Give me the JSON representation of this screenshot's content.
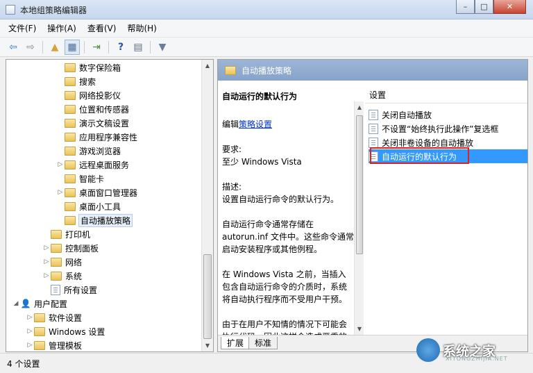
{
  "window": {
    "title": "本地组策略编辑器",
    "minimize": "–",
    "maximize": "□",
    "close": "✕"
  },
  "menu": [
    "文件(F)",
    "操作(A)",
    "查看(V)",
    "帮助(H)"
  ],
  "toolbar": {
    "icons": [
      "back-arrow-icon",
      "forward-arrow-icon",
      "folder-up-icon",
      "show-hide-tree-icon",
      "export-list-icon",
      "help-icon",
      "properties-icon",
      "filter-icon"
    ]
  },
  "tree": {
    "items": [
      {
        "label": "数字保险箱",
        "expandable": false,
        "icon": "folder"
      },
      {
        "label": "搜索",
        "expandable": false,
        "icon": "folder"
      },
      {
        "label": "网络投影仪",
        "expandable": false,
        "icon": "folder"
      },
      {
        "label": "位置和传感器",
        "expandable": false,
        "icon": "folder"
      },
      {
        "label": "演示文稿设置",
        "expandable": false,
        "icon": "folder"
      },
      {
        "label": "应用程序兼容性",
        "expandable": false,
        "icon": "folder"
      },
      {
        "label": "游戏浏览器",
        "expandable": false,
        "icon": "folder"
      },
      {
        "label": "远程桌面服务",
        "expandable": true,
        "icon": "folder"
      },
      {
        "label": "智能卡",
        "expandable": false,
        "icon": "folder"
      },
      {
        "label": "桌面窗口管理器",
        "expandable": true,
        "icon": "folder"
      },
      {
        "label": "桌面小工具",
        "expandable": false,
        "icon": "folder"
      },
      {
        "label": "自动播放策略",
        "expandable": false,
        "icon": "folder",
        "selected": true
      },
      {
        "label": "打印机",
        "expandable": false,
        "icon": "folder"
      },
      {
        "label": "控制面板",
        "expandable": true,
        "icon": "folder"
      },
      {
        "label": "网络",
        "expandable": true,
        "icon": "folder"
      },
      {
        "label": "系统",
        "expandable": true,
        "icon": "folder"
      },
      {
        "label": "所有设置",
        "expandable": false,
        "icon": "settings"
      },
      {
        "label": "用户配置",
        "expandable": true,
        "expanded": true,
        "icon": "user"
      },
      {
        "label": "软件设置",
        "expandable": true,
        "icon": "folder"
      },
      {
        "label": "Windows 设置",
        "expandable": true,
        "icon": "folder"
      },
      {
        "label": "管理模板",
        "expandable": true,
        "icon": "folder"
      }
    ]
  },
  "detail": {
    "header": "自动播放策略",
    "description": {
      "title": "自动运行的默认行为",
      "edit_prefix": "编辑",
      "edit_link": "策略设置",
      "requirements_label": "要求:",
      "requirements_value": "至少 Windows Vista",
      "description_label": "描述:",
      "description_value": "设置自动运行命令的默认行为。",
      "para1": "自动运行命令通常存储在 autorun.inf 文件中。这些命令通常启动安装程序或其他例程。",
      "para2": "在 Windows Vista 之前，当插入包含自动运行命令的介质时，系统将自动执行程序而不受用户干预。",
      "para3": "由于在用户不知情的情况下可能会执行代码，因此这样会造成严重的安全问题。Windows Vista 中的默"
    },
    "settings_header": "设置",
    "settings": [
      {
        "label": "关闭自动播放"
      },
      {
        "label": "不设置“始终执行此操作”复选框"
      },
      {
        "label": "关闭非卷设备的自动播放"
      },
      {
        "label": "自动运行的默认行为",
        "selected": true
      }
    ],
    "tabs": [
      "扩展",
      "标准"
    ]
  },
  "status": {
    "text": "4 个设置"
  },
  "watermark": {
    "text": "系统之家",
    "sub": "XITONGZHIJIA.NET"
  }
}
